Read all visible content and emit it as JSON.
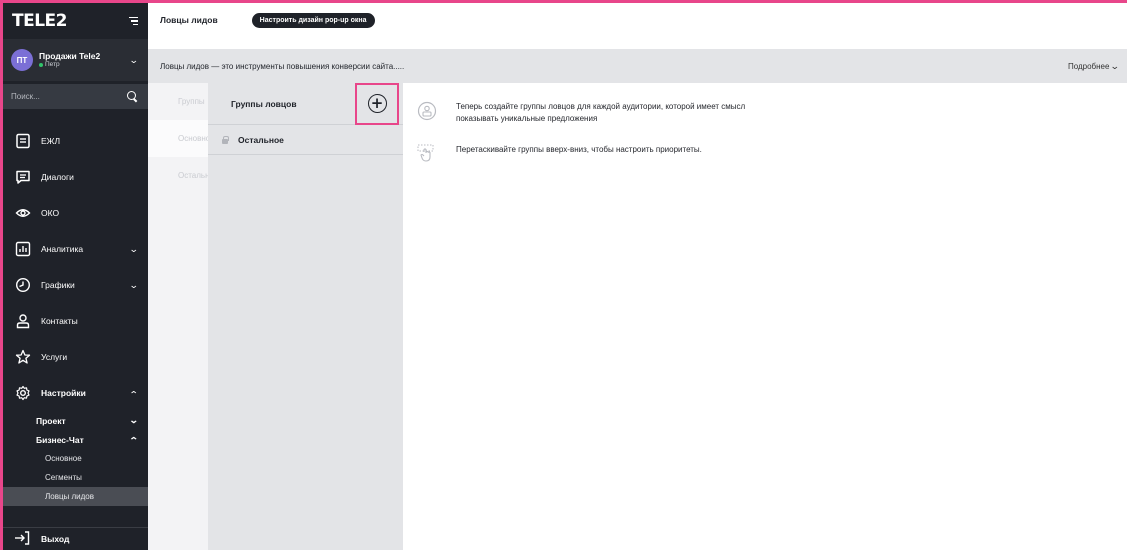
{
  "brand": {
    "logo": "TELE2",
    "accent": "#e8468a"
  },
  "account": {
    "initials": "ПТ",
    "name": "Продажи Tele2",
    "user": "Петр"
  },
  "search": {
    "placeholder": "Поиск..."
  },
  "nav": {
    "items": [
      {
        "label": "ЕЖЛ",
        "icon": "document-icon"
      },
      {
        "label": "Диалоги",
        "icon": "chat-icon"
      },
      {
        "label": "ОКО",
        "icon": "eye-icon"
      },
      {
        "label": "Аналитика",
        "icon": "chart-icon"
      },
      {
        "label": "Графики",
        "icon": "clock-icon"
      },
      {
        "label": "Контакты",
        "icon": "person-icon"
      },
      {
        "label": "Услуги",
        "icon": "star-icon"
      },
      {
        "label": "Настройки",
        "icon": "gear-icon"
      }
    ],
    "settings_sub": {
      "project": "Проект",
      "business_chat": "Бизнес-Чат"
    },
    "business_chat_sub": [
      "Основное",
      "Сегменты",
      "Ловцы лидов"
    ],
    "logout": "Выход"
  },
  "topbar": {
    "title": "Ловцы лидов",
    "design_button": "Настроить дизайн pop-up окна"
  },
  "infobar": {
    "text": "Ловцы лидов — это инструменты повышения конверсии сайта.....",
    "more": "Подробнее"
  },
  "back_column": {
    "header": "Группы",
    "rows": [
      "Основное",
      "Остальное"
    ]
  },
  "groups": {
    "header": "Группы ловцов",
    "rows": [
      "Остальное"
    ]
  },
  "hints": {
    "create_line1": "Теперь создайте группы ловцов для каждой аудитории, которой имеет смысл",
    "create_line2": "показывать уникальные предложения",
    "drag": "Перетаскивайте группы вверх-вниз, чтобы настроить приоритеты."
  }
}
